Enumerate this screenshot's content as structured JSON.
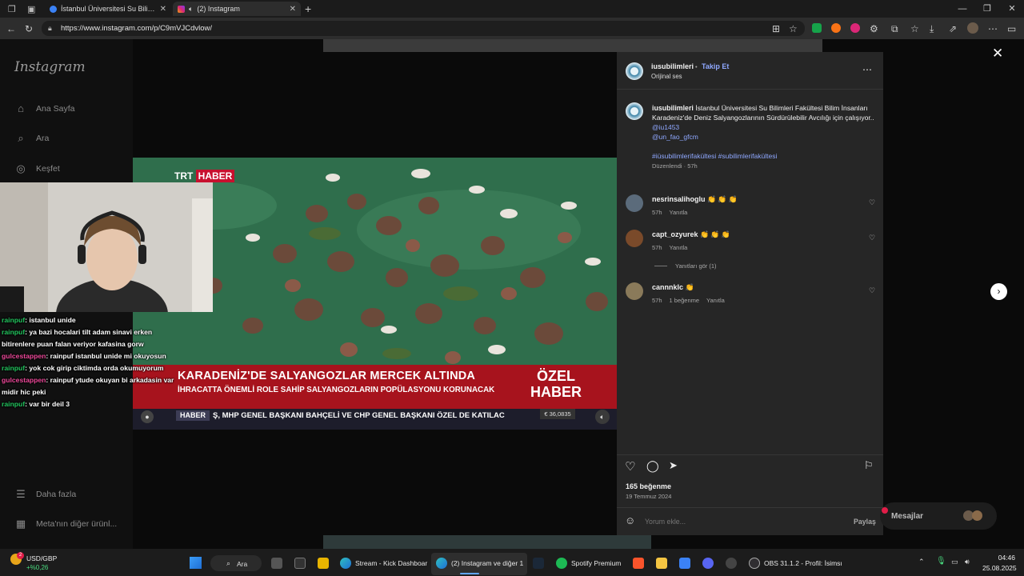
{
  "browser": {
    "tabs": [
      {
        "title": "İstanbul Üniversitesi Su Bilimleri F",
        "close": "✕"
      },
      {
        "title": "(2) Instagram",
        "close": "✕"
      }
    ],
    "new_tab": "+",
    "url": "https://www.instagram.com/p/C9mVJCdvlow/"
  },
  "sidebar": {
    "logo": "Instagram",
    "items": [
      {
        "label": "Ana Sayfa",
        "icon": "home-icon"
      },
      {
        "label": "Ara",
        "icon": "search-icon"
      },
      {
        "label": "Keşfet",
        "icon": "compass-icon"
      }
    ],
    "more": "Daha fazla",
    "meta": "Meta'nın diğer ürünl..."
  },
  "chat": [
    {
      "user": "rainpuf",
      "color": "#22c55e",
      "text": ": istanbul unide"
    },
    {
      "user": "rainpuf",
      "color": "#22c55e",
      "text": ": ya bazi hocalari tilt adam sinavi erken bitirenlere puan falan veriyor kafasina gorw"
    },
    {
      "user": "gulcestappen",
      "color": "#ec4899",
      "text": ": rainpuf istanbul unide mi okuyosun"
    },
    {
      "user": "rainpuf",
      "color": "#22c55e",
      "text": ": yok cok girip ciktimda orda okumuyorum"
    },
    {
      "user": "gulcestappen",
      "color": "#ec4899",
      "text": ": rainpuf ytude okuyan bi arkadasin var midir hic peki"
    },
    {
      "user": "rainpuf",
      "color": "#22c55e",
      "text": ": var bir deil 3"
    }
  ],
  "video": {
    "channel_logo_a": "TRT",
    "channel_logo_b": "HABER",
    "headline": "KARADENİZ'DE SALYANGOZLAR MERCEK ALTINDA",
    "subheadline": "İHRACATTA ÖNEMLİ ROLE SAHİP SALYANGOZLARIN POPÜLASYONU KORUNACAK",
    "special_a": "ÖZEL",
    "special_b": "HABER",
    "ticker_label": "HABER",
    "ticker": "Ş, MHP GENEL BAŞKANI BAHÇELİ VE CHP GENEL BAŞKANI ÖZEL DE KATILAC",
    "rate": "€ 36,0835"
  },
  "post": {
    "author": "iusubilimleri",
    "follow": "Takip Et",
    "audio": "Orijinal ses",
    "caption_text": "İstanbul Üniversitesi Su Bilimleri Fakültesi Bilim İnsanları Karadeniz'de Deniz Salyangozlarının Sürdürülebilir Avcılığı için çalışıyor..",
    "mention1": "@iu1453",
    "mention2": "@un_fao_gfcm",
    "hashtags": "#iüsubilimlerifakültesi #subilimlerifakültesi",
    "edited": "Düzenlendi · 57h",
    "comments": [
      {
        "user": "nesrinsalihoglu",
        "text": "👏 👏 👏",
        "time": "57h",
        "likes": "",
        "reply": "Yanıtla"
      },
      {
        "user": "capt_ozyurek",
        "text": "👏 👏 👏",
        "time": "57h",
        "likes": "",
        "reply": "Yanıtla"
      },
      {
        "user": "cannnklc",
        "text": "👏",
        "time": "57h",
        "likes": "1 beğenme",
        "reply": "Yanıtla"
      }
    ],
    "view_replies": "Yanıtları gör (1)",
    "likes": "165 beğenme",
    "date": "19 Temmuz 2024",
    "comment_placeholder": "Yorum ekle...",
    "share": "Paylaş"
  },
  "messages": {
    "label": "Mesajlar"
  },
  "taskbar": {
    "stock_name": "USD/GBP",
    "stock_change": "+%0,26",
    "badge": "2",
    "search": "Ara",
    "apps": [
      {
        "label": "Stream - Kick Dashboar",
        "icon": "edge-icon"
      },
      {
        "label": "(2) Instagram ve diğer 1",
        "icon": "edge-icon"
      },
      {
        "label": "Spotify Premium",
        "icon": "spotify-icon"
      },
      {
        "label": "OBS 31.1.2 - Profil: İsimsı",
        "icon": "obs-icon"
      }
    ],
    "time": "04:46",
    "date": "25.08.2025"
  },
  "colors": {
    "accent_link": "#8fa8ff",
    "trt_red": "#a7131d",
    "panel_bg": "#262626"
  }
}
